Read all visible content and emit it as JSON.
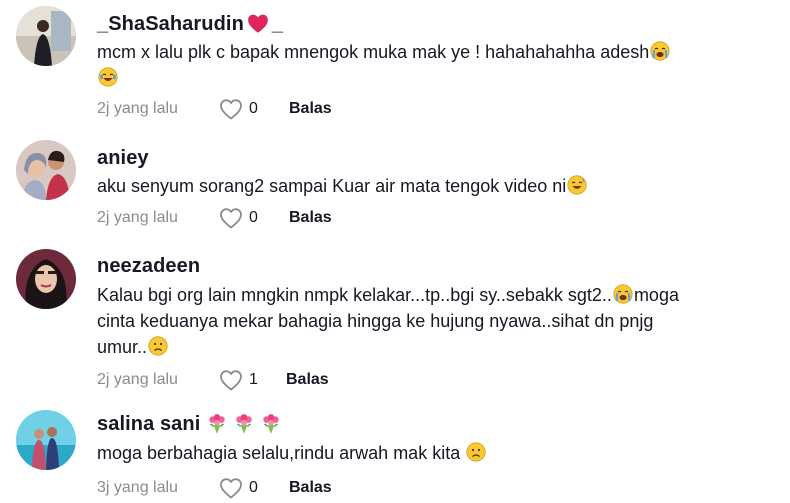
{
  "comments": [
    {
      "username": "_ShaSaharudin",
      "username_suffix": "_",
      "text_line1": "mcm x lalu plk c bapak mnengok muka mak ye ! hahahahahha adesh",
      "text_line2": "",
      "text_line3": "",
      "time": "2j yang lalu",
      "likes": "0",
      "reply": "Balas"
    },
    {
      "username": "aniey",
      "text_line1": "aku senyum sorang2 sampai Kuar air mata tengok video ni",
      "time": "2j yang lalu",
      "likes": "0",
      "reply": "Balas"
    },
    {
      "username": "neezadeen",
      "text_line1": "Kalau bgi org lain mngkin nmpk kelakar...tp..bgi sy..sebakk sgt2..",
      "text_line1b": "moga",
      "text_line2": "cinta keduanya mekar bahagia hingga ke hujung nyawa..sihat dn pnjg",
      "text_line3": "umur..",
      "time": "2j yang lalu",
      "likes": "1",
      "reply": "Balas"
    },
    {
      "username": "salina sani",
      "text_line1": "moga berbahagia selalu,rindu arwah mak kita",
      "time": "3j yang lalu",
      "likes": "0",
      "reply": "Balas"
    }
  ],
  "icons": {
    "heart": "heart-outline-icon",
    "red_heart": "red-heart-emoji",
    "crying": "loudly-crying-emoji",
    "joy": "tears-of-joy-emoji",
    "sweat_smile": "sweat-smile-emoji",
    "sad": "sad-face-emoji",
    "bouquet": "bouquet-emoji"
  },
  "colors": {
    "time_text": "#8a8b91",
    "primary_text": "#161823",
    "heart_red": "#e0245e"
  }
}
